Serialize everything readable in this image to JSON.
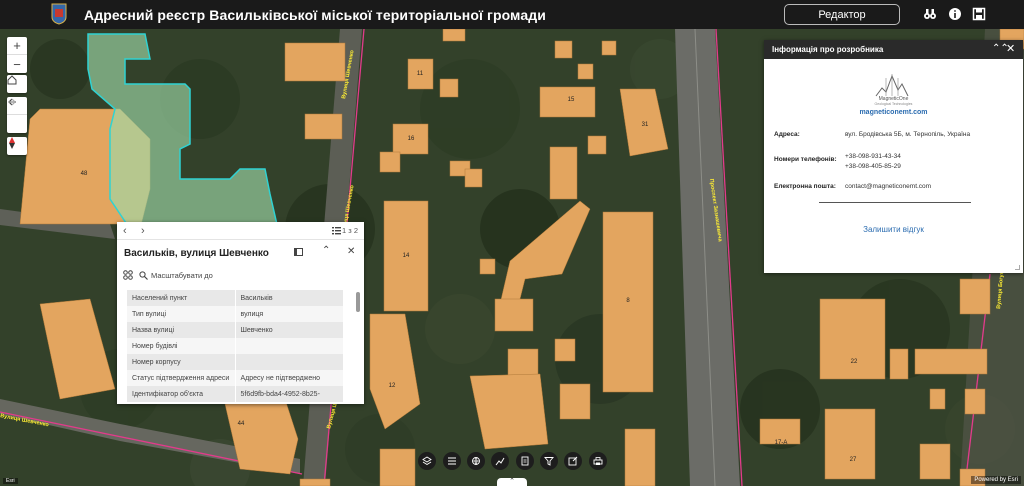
{
  "header": {
    "title": "Адресний реєстр Васильківської міської територіальної громади",
    "editor_button": "Редактор",
    "icons": [
      "binoculars-icon",
      "info-icon",
      "save-icon"
    ]
  },
  "map_controls": [
    "zoom-in-icon",
    "zoom-out-icon",
    "home-icon",
    "back-arrow-icon",
    "forward-arrow-icon",
    "compass-icon"
  ],
  "map_labels": {
    "houses": [
      "48",
      "11",
      "15",
      "31",
      "16",
      "14",
      "8",
      "12",
      "44",
      "22",
      "27",
      "17-А"
    ],
    "streets": [
      "Вулиця Шевченко",
      "Вулиця Шевченко",
      "Вулиця Шевченко",
      "Проспект Зазнашевича",
      "Вулиця Богуна",
      "Вулиця Шевченко"
    ]
  },
  "popup": {
    "count": "1 з 2",
    "title": "Васильків, вулиця Шевченко",
    "zoom_label": "Масштабувати до",
    "rows": [
      {
        "k": "Населений пункт",
        "v": "Васильків"
      },
      {
        "k": "Тип вулиці",
        "v": "вулиця"
      },
      {
        "k": "Назва вулиці",
        "v": "Шевченко"
      },
      {
        "k": "Номер будівлі",
        "v": ""
      },
      {
        "k": "Номер корпусу",
        "v": ""
      },
      {
        "k": "Статус підтвердження адреси",
        "v": "Адресу не підтверджено"
      },
      {
        "k": "Ідентифікатор об'єкта",
        "v": "5f6d9fb-bda4-4952-8b25-"
      }
    ]
  },
  "info_panel": {
    "title": "Інформація про розробника",
    "brand": "MagneticOne",
    "brand_sub": "Geological Technologies",
    "website": "magneticonemt.com",
    "address_label": "Адреса:",
    "address": "вул. Бродівська 5Б, м. Тернопіль, Україна",
    "phones_label": "Номери телефонів:",
    "phone1": "+38-098-931-43-34",
    "phone2": "+38-098-405-85-29",
    "email_label": "Електронна пошта:",
    "email": "contact@magneticonemt.com",
    "feedback": "Залишити відгук"
  },
  "toolbar": [
    "layers-icon",
    "list-icon",
    "basemap-icon",
    "analysis-icon",
    "print-icon",
    "filter-icon",
    "edit-icon",
    "printer-icon"
  ],
  "footer": {
    "powered_by": "Powered by Esri",
    "left_credit": "Esri"
  }
}
